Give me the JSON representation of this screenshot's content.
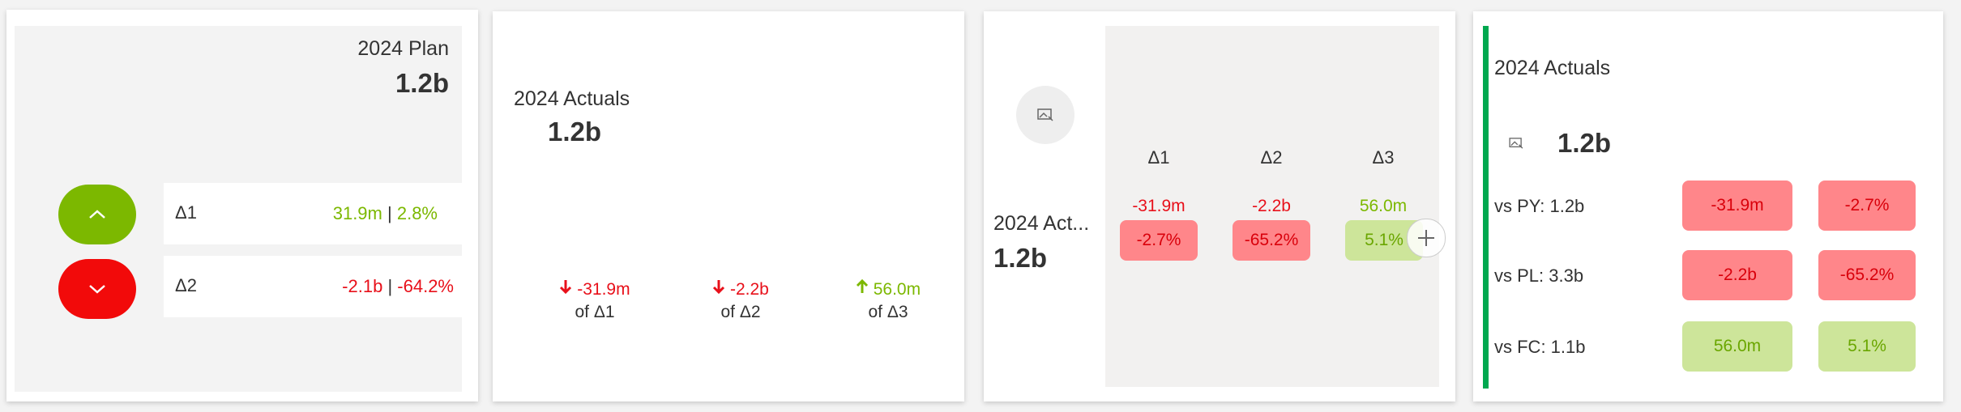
{
  "card1": {
    "title": "2024 Plan",
    "value": "1.2b",
    "rows": [
      {
        "label": "Δ1",
        "abs": "31.9m",
        "sep": "|",
        "pct": "2.8%",
        "trend": "up"
      },
      {
        "label": "Δ2",
        "abs": "-2.1b",
        "sep": "|",
        "pct": "-64.2%",
        "trend": "down"
      }
    ]
  },
  "card2": {
    "title": "2024 Actuals",
    "value": "1.2b",
    "deltas": [
      {
        "value": "-31.9m",
        "caption": "of Δ1",
        "trend": "down"
      },
      {
        "value": "-2.2b",
        "caption": "of Δ2",
        "trend": "down"
      },
      {
        "value": "56.0m",
        "caption": "of Δ3",
        "trend": "up"
      }
    ]
  },
  "card3": {
    "title": "2024 Act...",
    "value": "1.2b",
    "icon": "image-placeholder-icon",
    "columns": [
      {
        "header": "Δ1",
        "abs": "-31.9m",
        "pct": "-2.7%",
        "trend": "down"
      },
      {
        "header": "Δ2",
        "abs": "-2.2b",
        "pct": "-65.2%",
        "trend": "down"
      },
      {
        "header": "Δ3",
        "abs": "56.0m",
        "pct": "5.1%",
        "trend": "up"
      }
    ]
  },
  "card4": {
    "title": "2024 Actuals",
    "value": "1.2b",
    "icon": "image-placeholder-icon",
    "rows": [
      {
        "label": "vs PY: 1.2b",
        "abs": "-31.9m",
        "pct": "-2.7%",
        "trend": "down"
      },
      {
        "label": "vs PL: 3.3b",
        "abs": "-2.2b",
        "pct": "-65.2%",
        "trend": "down"
      },
      {
        "label": "vs FC: 1.1b",
        "abs": "56.0m",
        "pct": "5.1%",
        "trend": "up"
      }
    ]
  },
  "colors": {
    "positive": "#7cb800",
    "negative": "#e8101a",
    "negative_fill": "#ff868a",
    "positive_fill": "#cde59a",
    "accent_bar": "#00a84f"
  }
}
